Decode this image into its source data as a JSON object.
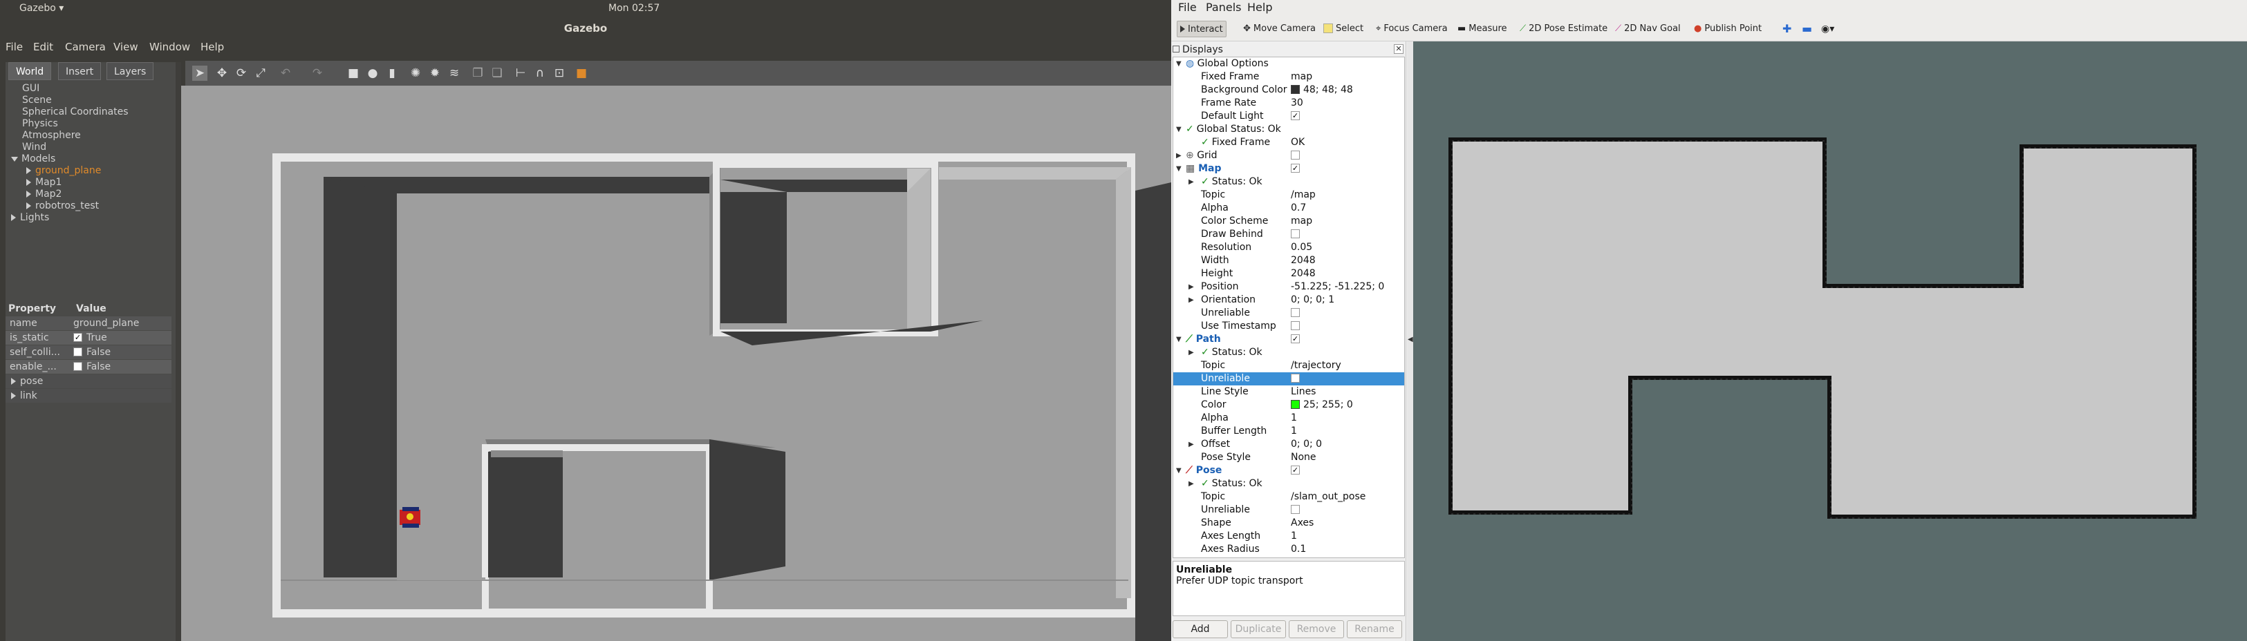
{
  "system_bar": {
    "app_menu": "Gazebo",
    "clock": "Mon 02:57"
  },
  "gazebo": {
    "window_title": "Gazebo",
    "menu": [
      "File",
      "Edit",
      "Camera",
      "View",
      "Window",
      "Help"
    ],
    "tabs": [
      "World",
      "Insert",
      "Layers"
    ],
    "tree": {
      "items": [
        "GUI",
        "Scene",
        "Spherical Coordinates",
        "Physics",
        "Atmosphere",
        "Wind"
      ],
      "models_label": "Models",
      "models": [
        "ground_plane",
        "Map1",
        "Map2",
        "robotros_test"
      ],
      "lights_label": "Lights"
    },
    "properties": {
      "header_property": "Property",
      "header_value": "Value",
      "rows": [
        {
          "key": "name",
          "value": "ground_plane"
        },
        {
          "key": "is_static",
          "value": "True",
          "checked": true
        },
        {
          "key": "self_colli...",
          "value": "False",
          "checked": false
        },
        {
          "key": "enable_...",
          "value": "False",
          "checked": false
        }
      ],
      "groups": [
        "pose",
        "link"
      ]
    }
  },
  "rviz": {
    "menu": [
      "File",
      "Panels",
      "Help"
    ],
    "tools": [
      "Interact",
      "Move Camera",
      "Select",
      "Focus Camera",
      "Measure",
      "2D Pose Estimate",
      "2D Nav Goal",
      "Publish Point"
    ],
    "active_tool": "Interact",
    "displays_title": "Displays",
    "displays": {
      "global_options": "Global Options",
      "fixed_frame": {
        "label": "Fixed Frame",
        "value": "map"
      },
      "background_color": {
        "label": "Background Color",
        "value": "48; 48; 48",
        "color": "#303030"
      },
      "frame_rate": {
        "label": "Frame Rate",
        "value": "30"
      },
      "default_light": {
        "label": "Default Light"
      },
      "global_status": "Global Status: Ok",
      "fixed_frame_status": {
        "label": "Fixed Frame",
        "value": "OK"
      },
      "grid": "Grid",
      "map": "Map",
      "map_status": "Status: Ok",
      "map_props": [
        {
          "label": "Topic",
          "value": "/map"
        },
        {
          "label": "Alpha",
          "value": "0.7"
        },
        {
          "label": "Color Scheme",
          "value": "map"
        },
        {
          "label": "Draw Behind",
          "value": ""
        },
        {
          "label": "Resolution",
          "value": "0.05"
        },
        {
          "label": "Width",
          "value": "2048"
        },
        {
          "label": "Height",
          "value": "2048"
        },
        {
          "label": "Position",
          "value": "-51.225; -51.225; 0"
        },
        {
          "label": "Orientation",
          "value": "0; 0; 0; 1"
        },
        {
          "label": "Unreliable",
          "value": ""
        },
        {
          "label": "Use Timestamp",
          "value": ""
        }
      ],
      "path": "Path",
      "path_status": "Status: Ok",
      "path_props": [
        {
          "label": "Topic",
          "value": "/trajectory"
        },
        {
          "label": "Unreliable",
          "value": ""
        },
        {
          "label": "Line Style",
          "value": "Lines"
        },
        {
          "label": "Color",
          "value": "25; 255; 0",
          "color": "#19ff00"
        },
        {
          "label": "Alpha",
          "value": "1"
        },
        {
          "label": "Buffer Length",
          "value": "1"
        },
        {
          "label": "Offset",
          "value": "0; 0; 0"
        },
        {
          "label": "Pose Style",
          "value": "None"
        }
      ],
      "pose": "Pose",
      "pose_status": "Status: Ok",
      "pose_props": [
        {
          "label": "Topic",
          "value": "/slam_out_pose"
        },
        {
          "label": "Unreliable",
          "value": ""
        },
        {
          "label": "Shape",
          "value": "Axes"
        },
        {
          "label": "Axes Length",
          "value": "1"
        },
        {
          "label": "Axes Radius",
          "value": "0.1"
        }
      ]
    },
    "description": {
      "title": "Unreliable",
      "text": "Prefer UDP topic transport"
    },
    "buttons": [
      "Add",
      "Duplicate",
      "Remove",
      "Rename"
    ]
  },
  "colors": {
    "accent": "#3a8fd6",
    "gazebo_bg": "#3c3b37",
    "rviz_view_bg": "#5a6b6b",
    "map_free": "#c8c8c8",
    "model_highlight": "#e08a2a"
  }
}
